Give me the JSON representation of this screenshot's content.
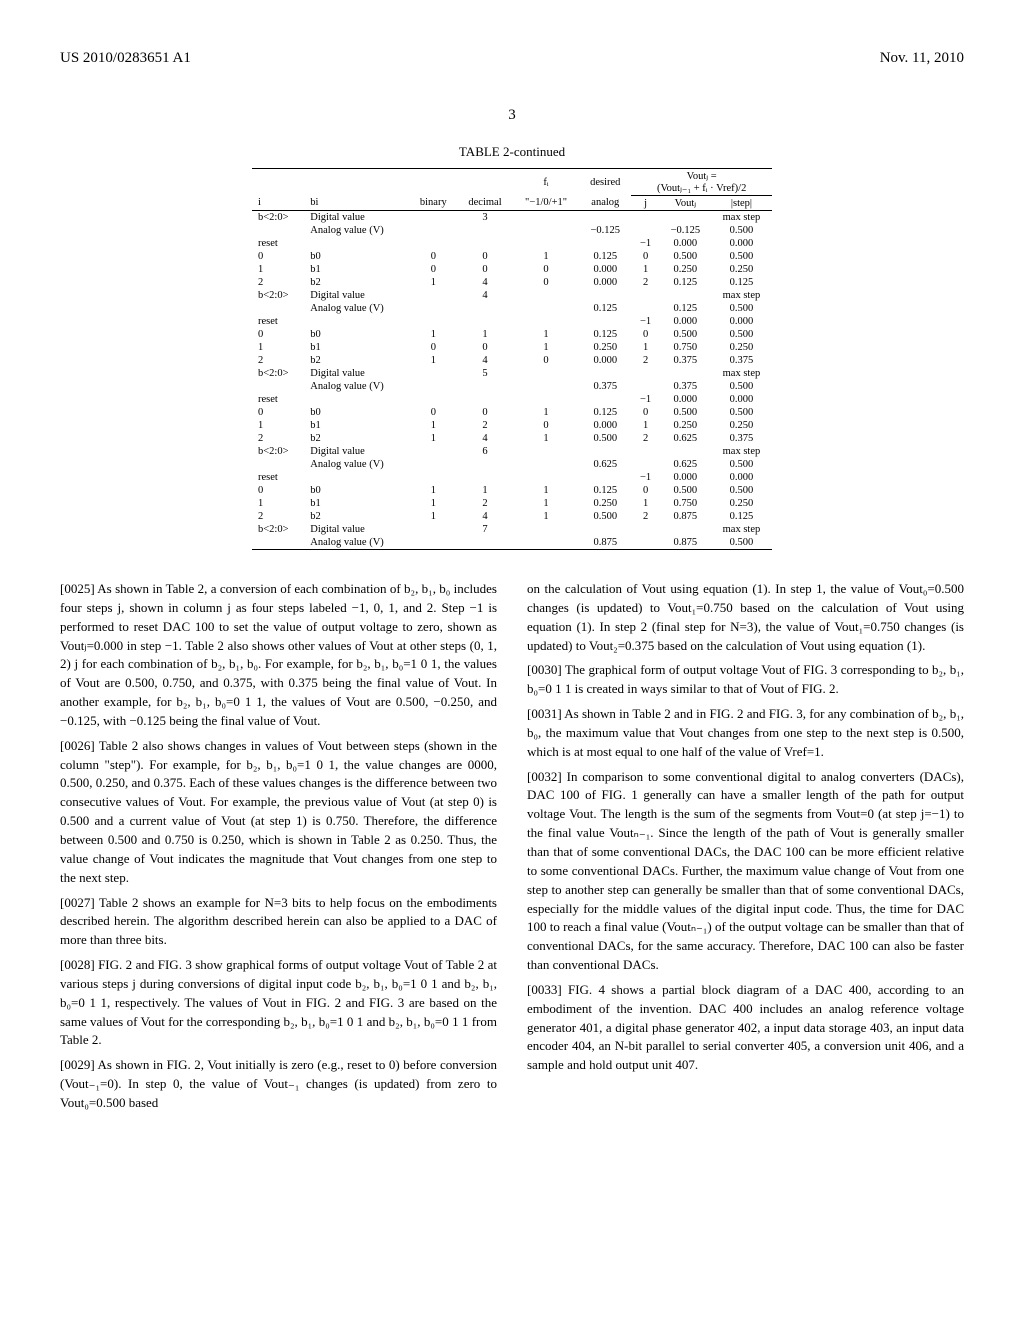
{
  "header": {
    "left": "US 2010/0283651 A1",
    "right": "Nov. 11, 2010"
  },
  "page_number": "3",
  "table": {
    "title": "TABLE 2-continued",
    "col_headers": {
      "i": "i",
      "bi": "bi",
      "binary": "binary",
      "decimal": "decimal",
      "fi": "fᵢ",
      "fi_sub": "\"−1/0/+1\"",
      "desired": "desired",
      "analog": "analog",
      "vout_formula_top": "Voutⱼ =",
      "vout_formula_bot": "(Voutⱼ₋₁ + fᵢ · Vref)/2",
      "j": "j",
      "voutj": "Voutⱼ",
      "step": "|step|"
    },
    "rows": [
      {
        "i": "b<2:0>",
        "bi": "Digital value",
        "binary": "",
        "decimal": "3",
        "fi": "",
        "desired": "",
        "j": "",
        "vout": "",
        "step": "max step"
      },
      {
        "i": "",
        "bi": "Analog value (V)",
        "binary": "",
        "decimal": "",
        "fi": "",
        "desired": "−0.125",
        "j": "",
        "vout": "−0.125",
        "step": "0.500"
      },
      {
        "i": "reset",
        "bi": "",
        "binary": "",
        "decimal": "",
        "fi": "",
        "desired": "",
        "j": "−1",
        "vout": "0.000",
        "step": "0.000"
      },
      {
        "i": "0",
        "bi": "b0",
        "binary": "0",
        "decimal": "0",
        "fi": "1",
        "desired": "0.125",
        "j": "0",
        "vout": "0.500",
        "step": "0.500"
      },
      {
        "i": "1",
        "bi": "b1",
        "binary": "0",
        "decimal": "0",
        "fi": "0",
        "desired": "0.000",
        "j": "1",
        "vout": "0.250",
        "step": "0.250"
      },
      {
        "i": "2",
        "bi": "b2",
        "binary": "1",
        "decimal": "4",
        "fi": "0",
        "desired": "0.000",
        "j": "2",
        "vout": "0.125",
        "step": "0.125"
      },
      {
        "i": "b<2:0>",
        "bi": "Digital value",
        "binary": "",
        "decimal": "4",
        "fi": "",
        "desired": "",
        "j": "",
        "vout": "",
        "step": "max step"
      },
      {
        "i": "",
        "bi": "Analog value (V)",
        "binary": "",
        "decimal": "",
        "fi": "",
        "desired": "0.125",
        "j": "",
        "vout": "0.125",
        "step": "0.500"
      },
      {
        "i": "reset",
        "bi": "",
        "binary": "",
        "decimal": "",
        "fi": "",
        "desired": "",
        "j": "−1",
        "vout": "0.000",
        "step": "0.000"
      },
      {
        "i": "0",
        "bi": "b0",
        "binary": "1",
        "decimal": "1",
        "fi": "1",
        "desired": "0.125",
        "j": "0",
        "vout": "0.500",
        "step": "0.500"
      },
      {
        "i": "1",
        "bi": "b1",
        "binary": "0",
        "decimal": "0",
        "fi": "1",
        "desired": "0.250",
        "j": "1",
        "vout": "0.750",
        "step": "0.250"
      },
      {
        "i": "2",
        "bi": "b2",
        "binary": "1",
        "decimal": "4",
        "fi": "0",
        "desired": "0.000",
        "j": "2",
        "vout": "0.375",
        "step": "0.375"
      },
      {
        "i": "b<2:0>",
        "bi": "Digital value",
        "binary": "",
        "decimal": "5",
        "fi": "",
        "desired": "",
        "j": "",
        "vout": "",
        "step": "max step"
      },
      {
        "i": "",
        "bi": "Analog value (V)",
        "binary": "",
        "decimal": "",
        "fi": "",
        "desired": "0.375",
        "j": "",
        "vout": "0.375",
        "step": "0.500"
      },
      {
        "i": "reset",
        "bi": "",
        "binary": "",
        "decimal": "",
        "fi": "",
        "desired": "",
        "j": "−1",
        "vout": "0.000",
        "step": "0.000"
      },
      {
        "i": "0",
        "bi": "b0",
        "binary": "0",
        "decimal": "0",
        "fi": "1",
        "desired": "0.125",
        "j": "0",
        "vout": "0.500",
        "step": "0.500"
      },
      {
        "i": "1",
        "bi": "b1",
        "binary": "1",
        "decimal": "2",
        "fi": "0",
        "desired": "0.000",
        "j": "1",
        "vout": "0.250",
        "step": "0.250"
      },
      {
        "i": "2",
        "bi": "b2",
        "binary": "1",
        "decimal": "4",
        "fi": "1",
        "desired": "0.500",
        "j": "2",
        "vout": "0.625",
        "step": "0.375"
      },
      {
        "i": "b<2:0>",
        "bi": "Digital value",
        "binary": "",
        "decimal": "6",
        "fi": "",
        "desired": "",
        "j": "",
        "vout": "",
        "step": "max step"
      },
      {
        "i": "",
        "bi": "Analog value (V)",
        "binary": "",
        "decimal": "",
        "fi": "",
        "desired": "0.625",
        "j": "",
        "vout": "0.625",
        "step": "0.500"
      },
      {
        "i": "reset",
        "bi": "",
        "binary": "",
        "decimal": "",
        "fi": "",
        "desired": "",
        "j": "−1",
        "vout": "0.000",
        "step": "0.000"
      },
      {
        "i": "0",
        "bi": "b0",
        "binary": "1",
        "decimal": "1",
        "fi": "1",
        "desired": "0.125",
        "j": "0",
        "vout": "0.500",
        "step": "0.500"
      },
      {
        "i": "1",
        "bi": "b1",
        "binary": "1",
        "decimal": "2",
        "fi": "1",
        "desired": "0.250",
        "j": "1",
        "vout": "0.750",
        "step": "0.250"
      },
      {
        "i": "2",
        "bi": "b2",
        "binary": "1",
        "decimal": "4",
        "fi": "1",
        "desired": "0.500",
        "j": "2",
        "vout": "0.875",
        "step": "0.125"
      },
      {
        "i": "b<2:0>",
        "bi": "Digital value",
        "binary": "",
        "decimal": "7",
        "fi": "",
        "desired": "",
        "j": "",
        "vout": "",
        "step": "max step"
      },
      {
        "i": "",
        "bi": "Analog value (V)",
        "binary": "",
        "decimal": "",
        "fi": "",
        "desired": "0.875",
        "j": "",
        "vout": "0.875",
        "step": "0.500"
      }
    ]
  },
  "paragraphs": {
    "p25": "[0025]   As shown in Table 2, a conversion of each combination of b₂, b₁, b₀ includes four steps j, shown in column j as four steps labeled −1, 0, 1, and 2. Step −1 is performed to reset DAC 100 to set the value of output voltage to zero, shown as Voutⱼ=0.000 in step −1. Table 2 also shows other values of Vout at other steps (0, 1, 2) j for each combination of b₂, b₁, b₀. For example, for b₂, b₁, b₀=1 0 1, the values of Vout are 0.500, 0.750, and 0.375, with 0.375 being the final value of Vout. In another example, for b₂, b₁, b₀=0 1 1, the values of Vout are 0.500, −0.250, and −0.125, with −0.125 being the final value of Vout.",
    "p26": "[0026]   Table 2 also shows changes in values of Vout between steps (shown in the column \"step\"). For example, for b₂, b₁, b₀=1 0 1, the value changes are 0000, 0.500, 0.250, and 0.375. Each of these values changes is the difference between two consecutive values of Vout. For example, the previous value of Vout (at step 0) is 0.500 and a current value of Vout (at step 1) is 0.750. Therefore, the difference between 0.500 and 0.750 is 0.250, which is shown in Table 2 as 0.250. Thus, the value change of Vout indicates the magnitude that Vout changes from one step to the next step.",
    "p27": "[0027]   Table 2 shows an example for N=3 bits to help focus on the embodiments described herein. The algorithm described herein can also be applied to a DAC of more than three bits.",
    "p28": "[0028]   FIG. 2 and FIG. 3 show graphical forms of output voltage Vout of Table 2 at various steps j during conversions of digital input code b₂, b₁, b₀=1 0 1 and b₂, b₁, b₀=0 1 1, respectively. The values of Vout in FIG. 2 and FIG. 3 are based on the same values of Vout for the corresponding b₂, b₁, b₀=1 0 1 and b₂, b₁, b₀=0 1 1 from Table 2.",
    "p29": "[0029]   As shown in FIG. 2, Vout initially is zero (e.g., reset to 0) before conversion (Vout₋₁=0). In step 0, the value of Vout₋₁ changes (is updated) from zero to Vout₀=0.500 based",
    "p29b": "on the calculation of Vout using equation (1). In step 1, the value of Vout₀=0.500 changes (is updated) to Vout₁=0.750 based on the calculation of Vout using equation (1). In step 2 (final step for N=3), the value of Vout₁=0.750 changes (is updated) to Vout₂=0.375 based on the calculation of Vout using equation (1).",
    "p30": "[0030]   The graphical form of output voltage Vout of FIG. 3 corresponding to b₂, b₁, b₀=0 1 1 is created in ways similar to that of Vout of FIG. 2.",
    "p31": "[0031]   As shown in Table 2 and in FIG. 2 and FIG. 3, for any combination of b₂, b₁, b₀, the maximum value that Vout changes from one step to the next step is 0.500, which is at most equal to one half of the value of Vref=1.",
    "p32": "[0032]   In comparison to some conventional digital to analog converters (DACs), DAC 100 of FIG. 1 generally can have a smaller length of the path for output voltage Vout. The length is the sum of the segments from Vout=0 (at step j=−1) to the final value Voutₙ₋₁. Since the length of the path of Vout is generally smaller than that of some conventional DACs, the DAC 100 can be more efficient relative to some conventional DACs. Further, the maximum value change of Vout from one step to another step can generally be smaller than that of some conventional DACs, especially for the middle values of the digital input code. Thus, the time for DAC 100 to reach a final value (Voutₙ₋₁) of the output voltage can be smaller than that of conventional DACs, for the same accuracy. Therefore, DAC 100 can also be faster than conventional DACs.",
    "p33": "[0033]   FIG. 4 shows a partial block diagram of a DAC 400, according to an embodiment of the invention. DAC 400 includes an analog reference voltage generator 401, a digital phase generator 402, a input data storage 403, an input data encoder 404, an N-bit parallel to serial converter 405, a conversion unit 406, and a sample and hold output unit 407."
  }
}
